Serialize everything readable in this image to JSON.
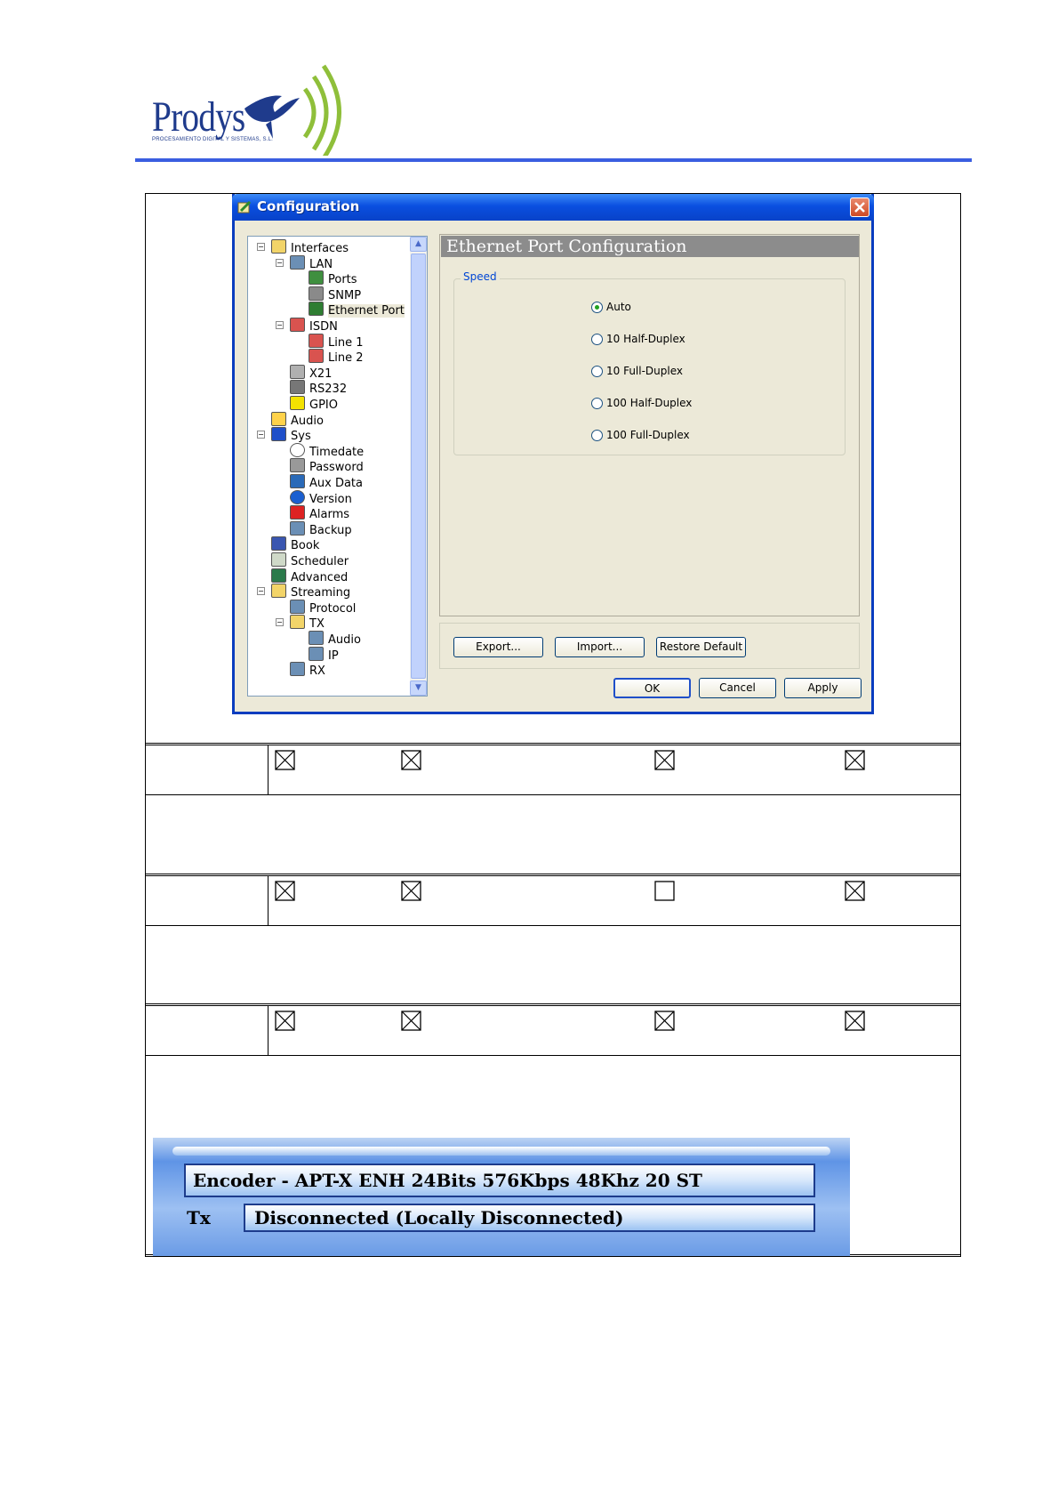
{
  "header": {
    "logo_text": "Prodys",
    "logo_subtitle": "PROCESAMIENTO DIGITAL Y SISTEMAS, S.L."
  },
  "colors": {
    "header_rule": "#3a5ee0",
    "xp_title_blue": "#0a4fe0",
    "dialog_face": "#ece9d8",
    "logo_blue": "#1f3b8c",
    "logo_green": "#8fbf3a"
  },
  "dialog": {
    "title": "Configuration",
    "tree": [
      {
        "label": "Interfaces",
        "icon": "folder-icon"
      },
      {
        "label": "LAN",
        "icon": "network-icon"
      },
      {
        "label": "Ports",
        "icon": "globe-icon"
      },
      {
        "label": "SNMP",
        "icon": "snmp-icon"
      },
      {
        "label": "Ethernet Port",
        "icon": "ethernet-card-icon"
      },
      {
        "label": "ISDN",
        "icon": "isdn-icon"
      },
      {
        "label": "Line 1",
        "icon": "isdn-line-icon"
      },
      {
        "label": "Line 2",
        "icon": "isdn-line-icon"
      },
      {
        "label": "X21",
        "icon": "x21-connector-icon"
      },
      {
        "label": "RS232",
        "icon": "serial-cable-icon"
      },
      {
        "label": "GPIO",
        "icon": "gpo-icon"
      },
      {
        "label": "Audio",
        "icon": "speaker-icon"
      },
      {
        "label": "Sys",
        "icon": "monitor-icon"
      },
      {
        "label": "Timedate",
        "icon": "clock-icon"
      },
      {
        "label": "Password",
        "icon": "keys-icon"
      },
      {
        "label": "Aux Data",
        "icon": "aux-data-icon"
      },
      {
        "label": "Version",
        "icon": "help-icon"
      },
      {
        "label": "Alarms",
        "icon": "alarm-icon"
      },
      {
        "label": "Backup",
        "icon": "network-icon"
      },
      {
        "label": "Book",
        "icon": "book-icon"
      },
      {
        "label": "Scheduler",
        "icon": "scheduler-icon"
      },
      {
        "label": "Advanced",
        "icon": "advanced-icon"
      },
      {
        "label": "Streaming",
        "icon": "folder-icon"
      },
      {
        "label": "Protocol",
        "icon": "network-icon"
      },
      {
        "label": "TX",
        "icon": "folder-icon"
      },
      {
        "label": "Audio",
        "icon": "network-icon"
      },
      {
        "label": "IP",
        "icon": "network-icon"
      },
      {
        "label": "RX",
        "icon": "network-icon"
      }
    ],
    "panel_title": "Ethernet Port Configuration",
    "speed_legend": "Speed",
    "speed_options": [
      {
        "label": "Auto",
        "selected": true
      },
      {
        "label": "10 Half-Duplex",
        "selected": false
      },
      {
        "label": "10 Full-Duplex",
        "selected": false
      },
      {
        "label": "100 Half-Duplex",
        "selected": false
      },
      {
        "label": "100 Full-Duplex",
        "selected": false
      }
    ],
    "buttons": {
      "export": "Export...",
      "import": "Import...",
      "restore": "Restore Default",
      "ok": "OK",
      "cancel": "Cancel",
      "apply": "Apply"
    }
  },
  "table_rows": [
    {
      "checks": [
        true,
        true,
        true,
        true
      ]
    },
    {
      "checks": [
        true,
        true,
        false,
        true
      ]
    },
    {
      "checks": [
        true,
        true,
        true,
        true
      ]
    }
  ],
  "status": {
    "encoder": "Encoder -  APT-X ENH 24Bits 576Kbps 48Khz 20 ST",
    "tx_label": "Tx",
    "tx_value": "Disconnected (Locally Disconnected)"
  }
}
